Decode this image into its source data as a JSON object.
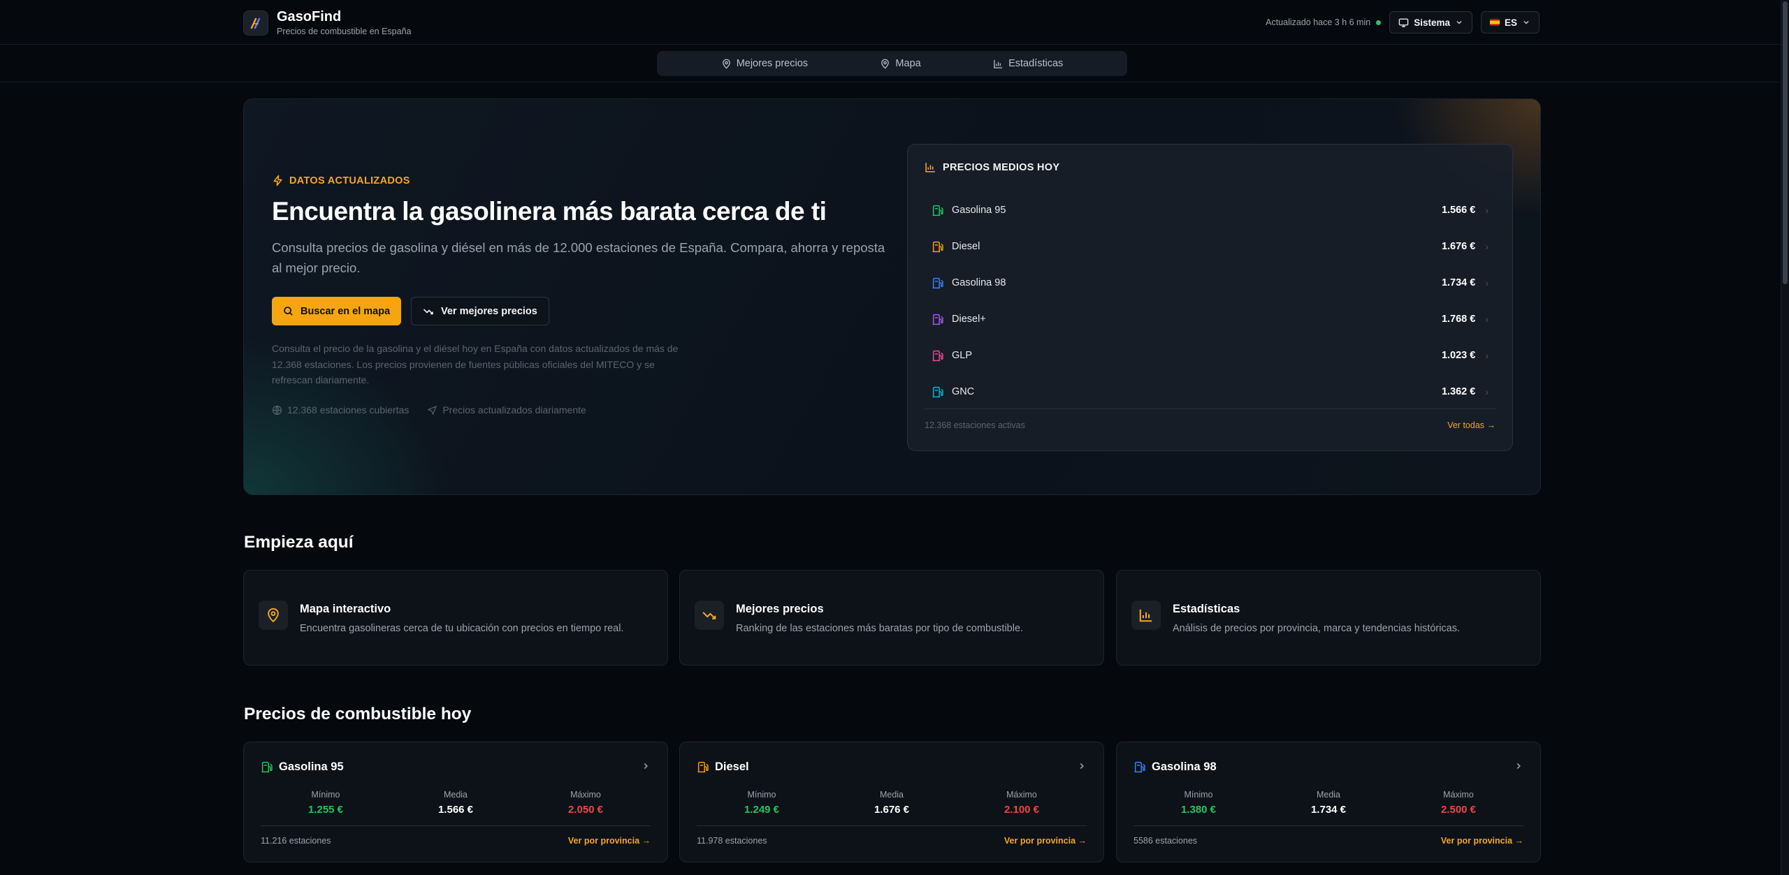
{
  "app": {
    "name": "GasoFind",
    "tagline": "Precios de combustible en España",
    "updated": "Actualizado hace 3 h 6 min",
    "theme_label": "Sistema",
    "language": "ES"
  },
  "nav": {
    "tabs": [
      {
        "label": "Mejores precios",
        "icon": "map-pin-icon"
      },
      {
        "label": "Mapa",
        "icon": "map-pin-icon"
      },
      {
        "label": "Estadísticas",
        "icon": "bar-chart-icon"
      }
    ]
  },
  "hero": {
    "badge": "DATOS ACTUALIZADOS",
    "title": "Encuentra la gasolinera más barata cerca de ti",
    "description": "Consulta precios de gasolina y diésel en más de 12.000 estaciones de España. Compara, ahorra y reposta al mejor precio.",
    "primary_button": "Buscar en el mapa",
    "secondary_button": "Ver mejores precios",
    "note": "Consulta el precio de la gasolina y el diésel hoy en España con datos actualizados de más de 12.368 estaciones. Los precios provienen de fuentes públicas oficiales del MITECO y se refrescan diariamente.",
    "meta_stations": "12.368 estaciones cubiertas",
    "meta_updates": "Precios actualizados diariamente"
  },
  "avg_prices": {
    "title": "PRECIOS MEDIOS HOY",
    "rows": [
      {
        "name": "Gasolina 95",
        "price": "1.566 €",
        "color": "#22c55e"
      },
      {
        "name": "Diesel",
        "price": "1.676 €",
        "color": "#f59e0b"
      },
      {
        "name": "Gasolina 98",
        "price": "1.734 €",
        "color": "#3b82f6"
      },
      {
        "name": "Diesel+",
        "price": "1.768 €",
        "color": "#a855f7"
      },
      {
        "name": "GLP",
        "price": "1.023 €",
        "color": "#ec4899"
      },
      {
        "name": "GNC",
        "price": "1.362 €",
        "color": "#06b6d4"
      }
    ],
    "active_stations": "12.368 estaciones activas",
    "see_all": "Ver todas →"
  },
  "start": {
    "title": "Empieza aquí",
    "cards": [
      {
        "title": "Mapa interactivo",
        "desc": "Encuentra gasolineras cerca de tu ubicación con precios en tiempo real.",
        "icon": "map-pin-icon"
      },
      {
        "title": "Mejores precios",
        "desc": "Ranking de las estaciones más baratas por tipo de combustible.",
        "icon": "trending-down-icon"
      },
      {
        "title": "Estadísticas",
        "desc": "Análisis de precios por provincia, marca y tendencias históricas.",
        "icon": "bar-chart-icon"
      }
    ]
  },
  "today": {
    "title": "Precios de combustible hoy",
    "labels": {
      "min": "Mínimo",
      "avg": "Media",
      "max": "Máximo"
    },
    "link": "Ver por provincia →",
    "cards": [
      {
        "name": "Gasolina 95",
        "color": "#22c55e",
        "min": "1.255 €",
        "avg": "1.566 €",
        "max": "2.050 €",
        "stations": "11.216 estaciones"
      },
      {
        "name": "Diesel",
        "color": "#f59e0b",
        "min": "1.249 €",
        "avg": "1.676 €",
        "max": "2.100 €",
        "stations": "11.978 estaciones"
      },
      {
        "name": "Gasolina 98",
        "color": "#3b82f6",
        "min": "1.380 €",
        "avg": "1.734 €",
        "max": "2.500 €",
        "stations": "5586 estaciones"
      }
    ]
  },
  "colors": {
    "accent": "#f5a623",
    "min_value": "#22c55e",
    "max_value": "#ef4444"
  }
}
